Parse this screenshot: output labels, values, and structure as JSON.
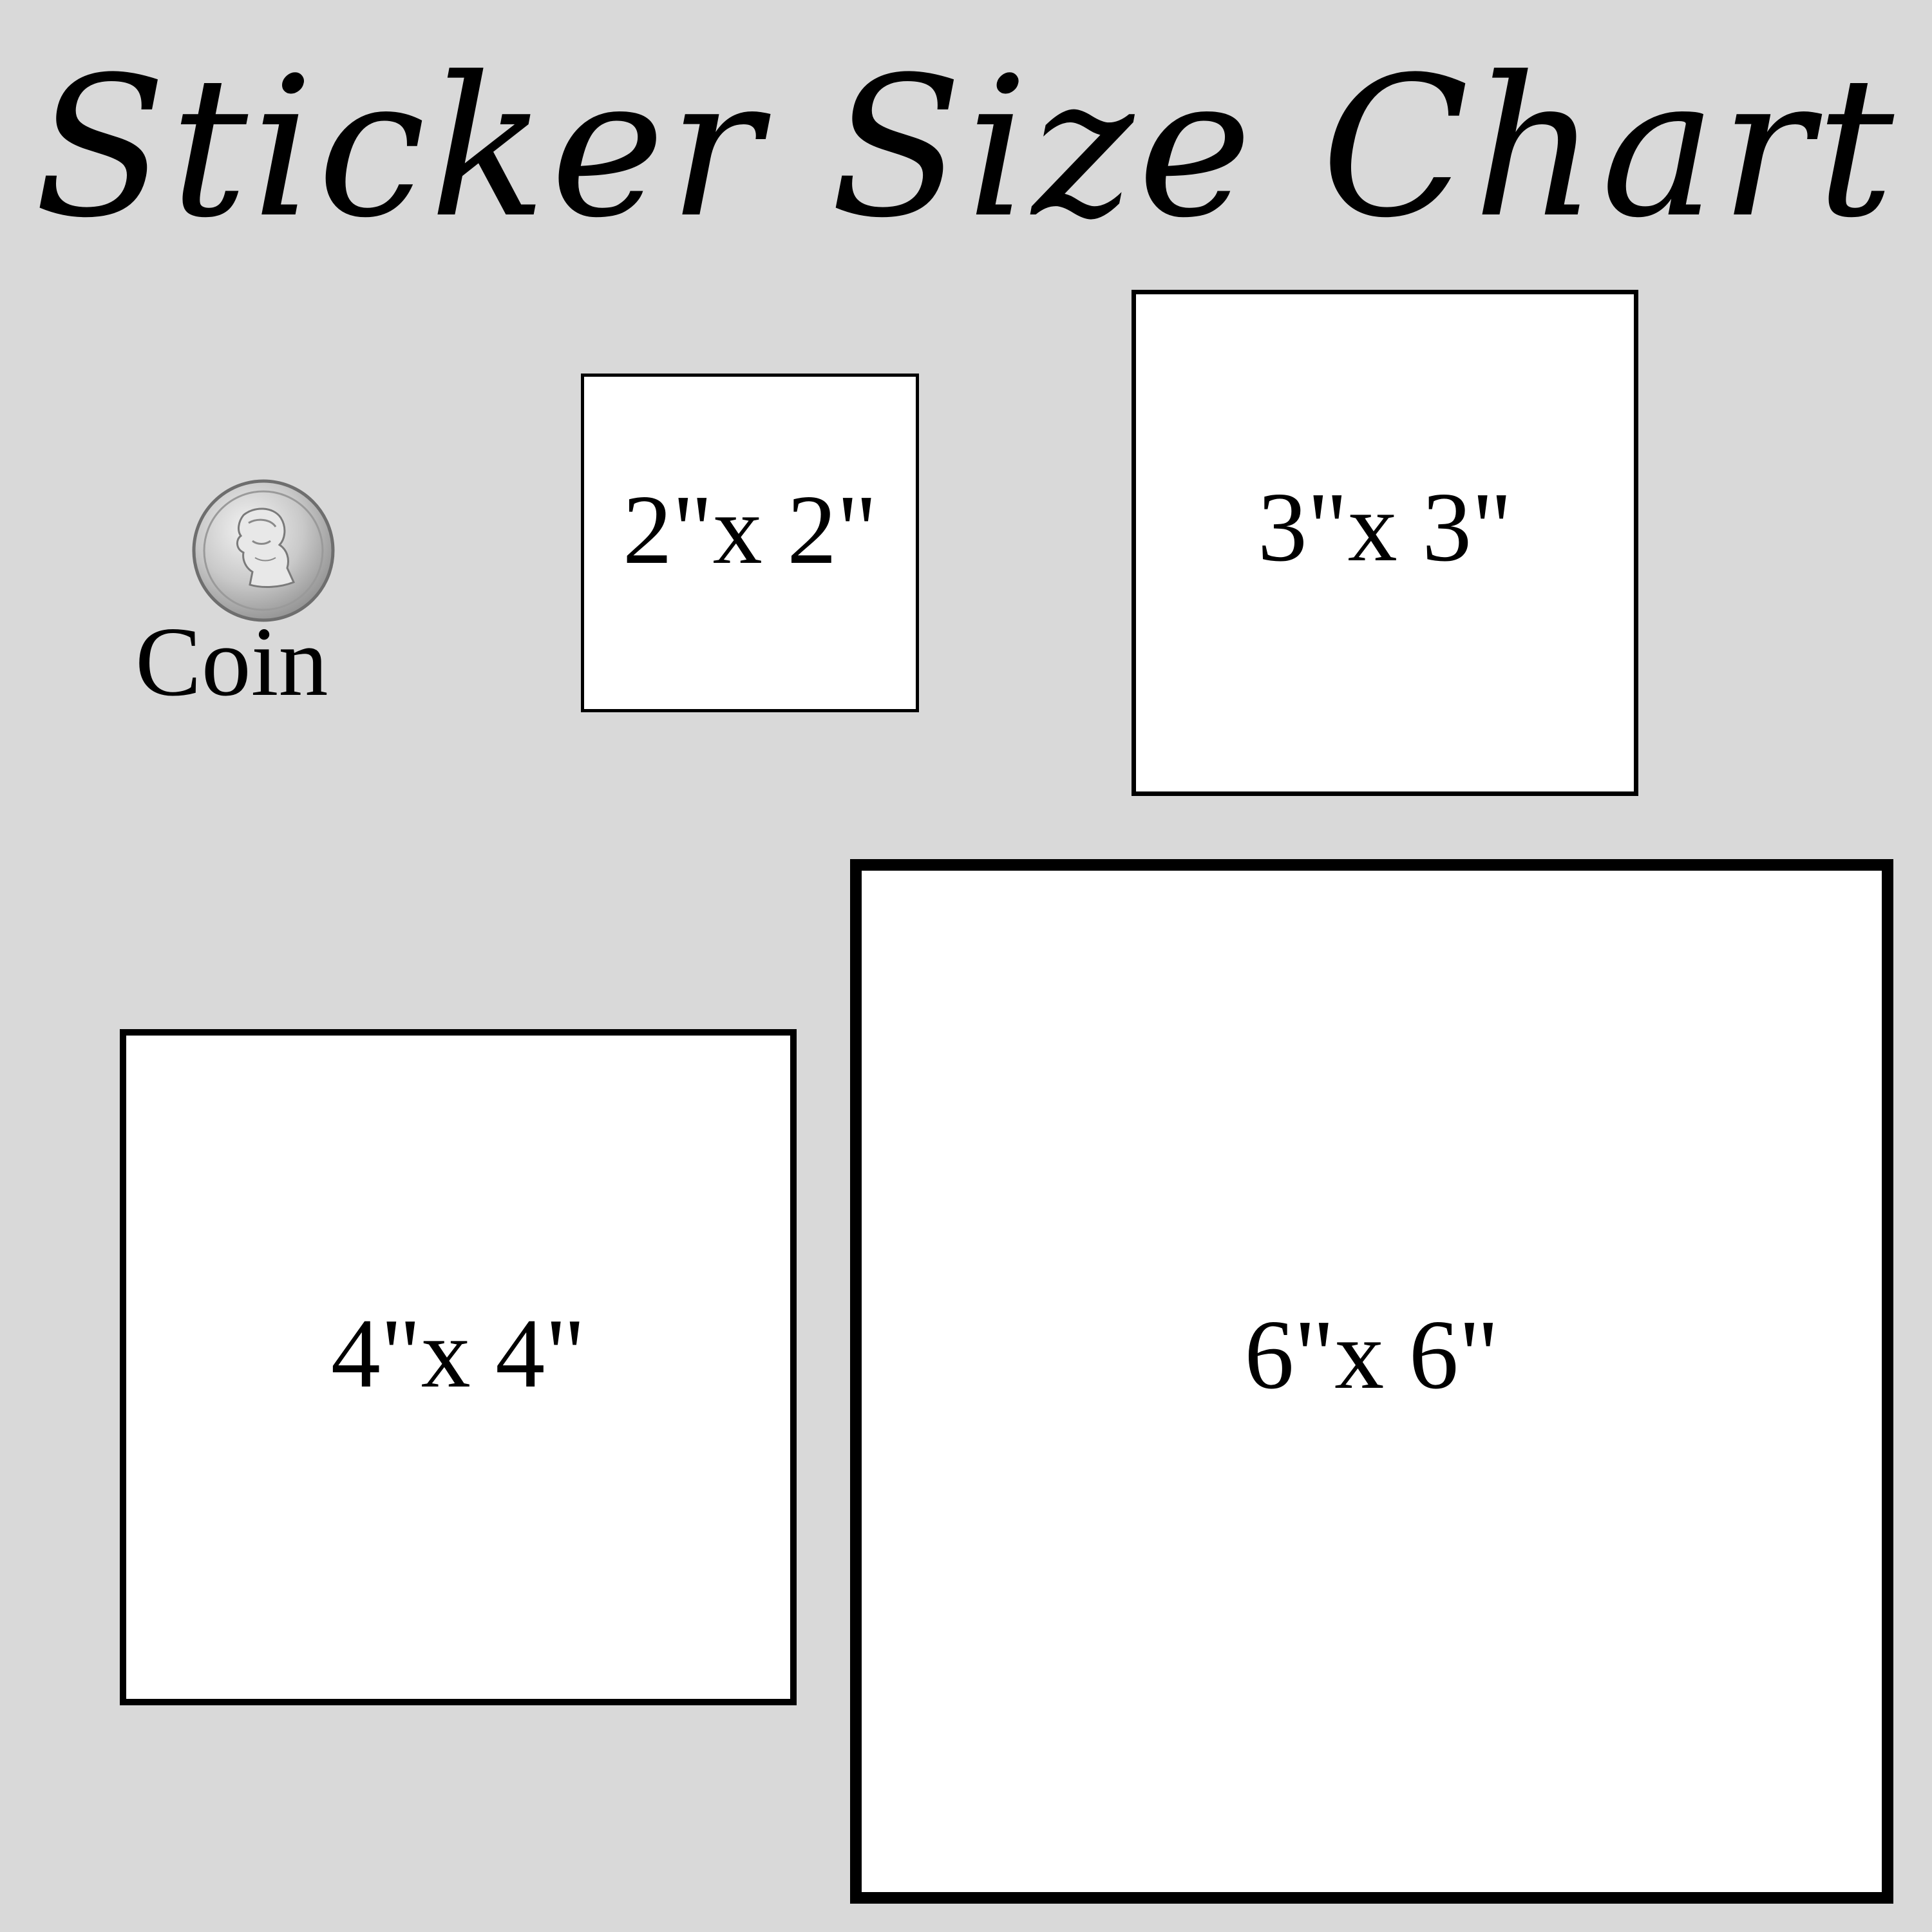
{
  "title": "Sticker Size Chart",
  "coin": {
    "label": "Coin",
    "icon": "nickel-coin-icon"
  },
  "stickers": [
    {
      "label": "2\"x 2\"",
      "width_in": 2,
      "height_in": 2
    },
    {
      "label": "3\"x 3\"",
      "width_in": 3,
      "height_in": 3
    },
    {
      "label": "4\"x 4\"",
      "width_in": 4,
      "height_in": 4
    },
    {
      "label": "6\"x 6\"",
      "width_in": 6,
      "height_in": 6
    }
  ],
  "colors": {
    "background": "#d9d9d9",
    "sticker_fill": "#ffffff",
    "outline": "#000000"
  }
}
